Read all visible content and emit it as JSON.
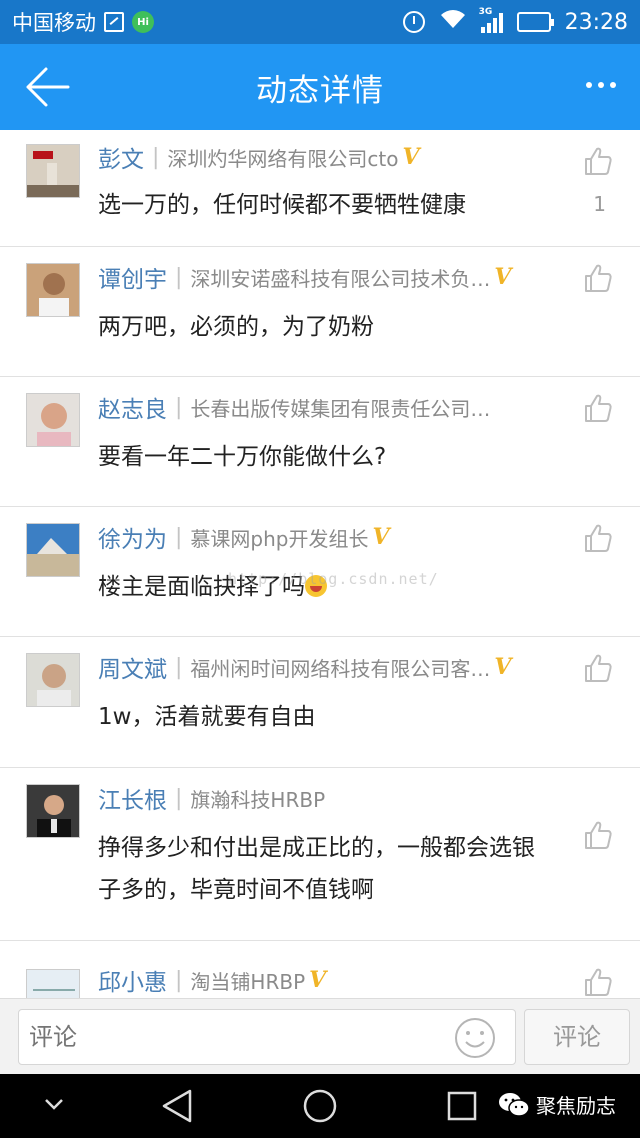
{
  "status_bar": {
    "carrier": "中国移动",
    "hi_badge": "Hi",
    "network": "3G",
    "time": "23:28"
  },
  "app_bar": {
    "title": "动态详情"
  },
  "comments": [
    {
      "name": "彭文",
      "company": "深圳灼华网络有限公司cto",
      "verified": "V",
      "content": "选一万的，任何时候都不要牺牲健康",
      "likes": "1"
    },
    {
      "name": "谭创宇",
      "company": "深圳安诺盛科技有限公司技术负…",
      "verified": "V",
      "content": "两万吧，必须的，为了奶粉",
      "likes": ""
    },
    {
      "name": "赵志良",
      "company": "长春出版传媒集团有限责任公司…",
      "verified": "",
      "content": "要看一年二十万你能做什么?",
      "likes": ""
    },
    {
      "name": "徐为为",
      "company": "慕课网php开发组长",
      "verified": "V",
      "content": "楼主是面临抉择了吗",
      "likes": ""
    },
    {
      "name": "周文斌",
      "company": "福州闲时间网络科技有限公司客…",
      "verified": "V",
      "content": "1w，活着就要有自由",
      "likes": ""
    },
    {
      "name": "江长根",
      "company": "旗瀚科技HRBP",
      "verified": "",
      "content": "挣得多少和付出是成正比的，一般都会选银子多的，毕竟时间不值钱啊",
      "likes": ""
    },
    {
      "name": "邱小惠",
      "company": "淘当铺HRBP",
      "verified": "V",
      "content": "",
      "likes": ""
    }
  ],
  "watermark": "http://blog.csdn.net/",
  "input_bar": {
    "placeholder": "评论",
    "submit_label": "评论"
  },
  "wechat_tag": "聚焦励志",
  "colors": {
    "status_bar": "#1877c9",
    "app_bar": "#2196f3",
    "name": "#4a7fb5",
    "verified": "#f0b428"
  }
}
